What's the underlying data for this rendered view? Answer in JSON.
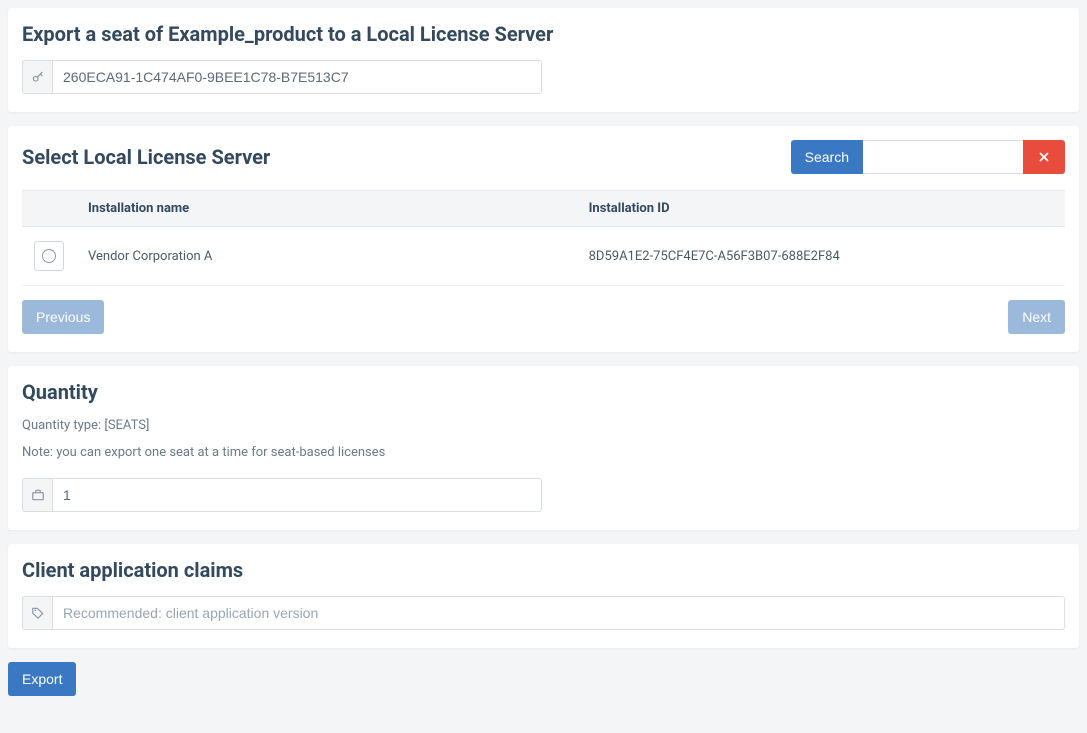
{
  "header": {
    "title": "Export a seat of Example_product to a Local License Server",
    "license_key": "260ECA91-1C474AF0-9BEE1C78-B7E513C7"
  },
  "server_select": {
    "title": "Select Local License Server",
    "search_label": "Search",
    "search_value": "",
    "columns": {
      "name": "Installation name",
      "id": "Installation ID"
    },
    "rows": [
      {
        "name": "Vendor Corporation A",
        "id": "8D59A1E2-75CF4E7C-A56F3B07-688E2F84"
      }
    ],
    "previous_label": "Previous",
    "next_label": "Next"
  },
  "quantity": {
    "title": "Quantity",
    "type_label": "Quantity type: [SEATS]",
    "note": "Note: you can export one seat at a time for seat-based licenses",
    "value": "1"
  },
  "claims": {
    "title": "Client application claims",
    "placeholder": "Recommended: client application version",
    "value": ""
  },
  "footer": {
    "export_label": "Export"
  }
}
